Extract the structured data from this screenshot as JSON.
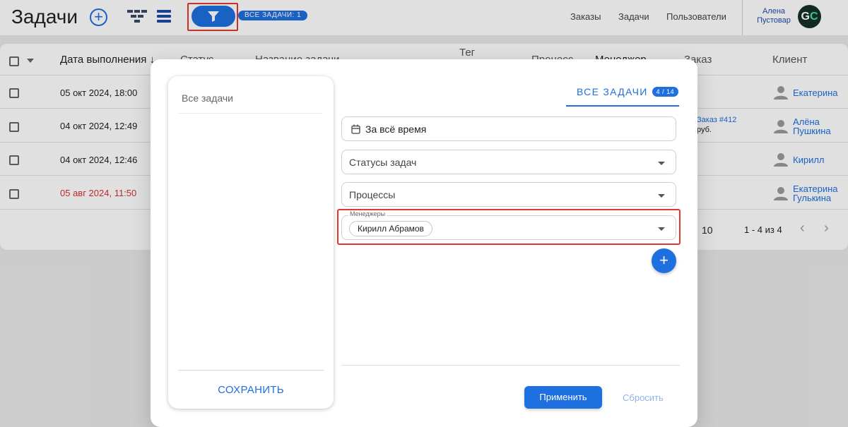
{
  "header": {
    "title": "Задачи",
    "add_symbol": "+",
    "all_tasks_badge": "ВСЕ ЗАДАЧИ: 1",
    "nav": [
      "Заказы",
      "Задачи",
      "Пользователи"
    ],
    "user": {
      "first_name": "Алена",
      "last_name": "Пустовар",
      "initial_1": "G",
      "initial_2": "C"
    }
  },
  "table": {
    "columns": {
      "due_date": "Дата выполнения ↓",
      "status": "Статус",
      "task_name": "Название задачи",
      "tag": "Тег",
      "process": "Процесс",
      "manager": "Менеджер",
      "order": "Заказ",
      "client": "Клиент"
    },
    "rows": [
      {
        "date": "05 окт 2024, 18:00",
        "client": "Екатерина",
        "client_2": ""
      },
      {
        "date": "04 окт 2024, 12:49",
        "client": "Алёна",
        "client_2": "Пушкина",
        "order_link": "Заказ #412",
        "order_sum": "руб."
      },
      {
        "date": "04 окт 2024, 12:46",
        "client": "Кирилл",
        "client_2": ""
      },
      {
        "date": "05 авг 2024, 11:50",
        "client": "Екатерина",
        "client_2": "Гулькина"
      }
    ],
    "pagination": {
      "rows_per_page": "10",
      "range": "1 - 4 из 4",
      "prev": "‹",
      "next": "›"
    }
  },
  "modal": {
    "saved_filters": [
      "Все задачи"
    ],
    "save_label": "СОХРАНИТЬ",
    "tab": {
      "label": "ВСЕ ЗАДАЧИ",
      "count": "4 / 14"
    },
    "date_filter": "За всё время",
    "status_filter_placeholder": "Статусы задач",
    "process_filter_placeholder": "Процессы",
    "managers_label": "Менеджеры",
    "managers_selected": [
      "Кирилл Абрамов"
    ],
    "add_symbol": "+",
    "apply_label": "Применить",
    "reset_label": "Сбросить"
  },
  "colors": {
    "accent": "#1e6fe0",
    "highlight": "#e03a30",
    "overdue": "#d83030"
  }
}
